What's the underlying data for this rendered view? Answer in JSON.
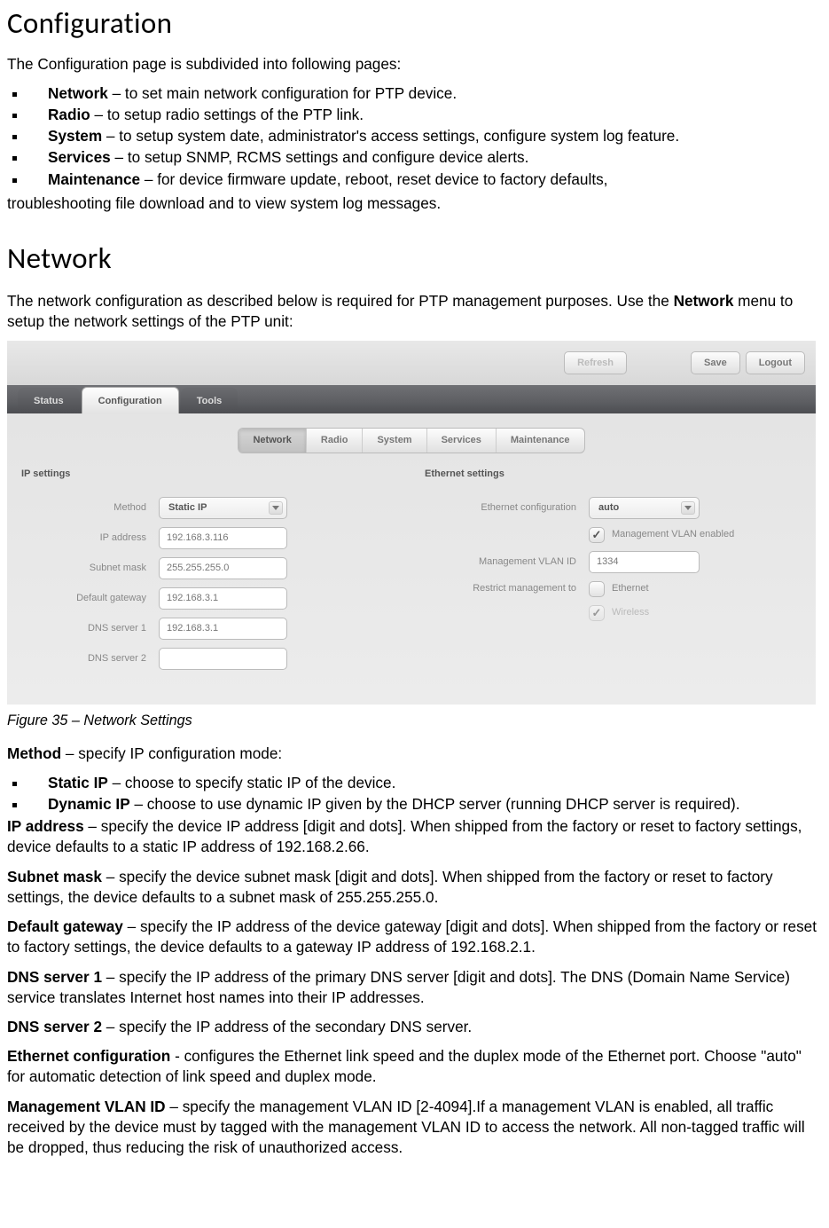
{
  "heading_config": "Configuration",
  "intro": "The Configuration page is subdivided into following pages:",
  "pages": [
    {
      "name": "Network",
      "desc": " – to set main network configuration for PTP device."
    },
    {
      "name": "Radio",
      "desc": " – to setup radio settings of the PTP link."
    },
    {
      "name": "System",
      "desc": " – to setup system date, administrator's access settings, configure system log feature."
    },
    {
      "name": "Services",
      "desc": " – to setup SNMP, RCMS settings and configure device alerts."
    },
    {
      "name": "Maintenance",
      "desc": " – for device firmware update, reboot, reset device to factory defaults,"
    }
  ],
  "maint_cont": "troubleshooting file download and to view system log messages.",
  "heading_network": "Network",
  "network_intro_1": "The network configuration as described below is required for PTP management purposes. Use the ",
  "network_intro_b": "Network",
  "network_intro_2": " menu to setup the network settings of the PTP unit:",
  "ui": {
    "topbar": {
      "refresh": "Refresh",
      "save": "Save",
      "logout": "Logout"
    },
    "maintabs": [
      "Status",
      "Configuration",
      "Tools"
    ],
    "subtabs": [
      "Network",
      "Radio",
      "System",
      "Services",
      "Maintenance"
    ],
    "ip": {
      "title": "IP settings",
      "method_lbl": "Method",
      "method_val": "Static IP",
      "addr_lbl": "IP address",
      "addr_val": "192.168.3.116",
      "mask_lbl": "Subnet mask",
      "mask_val": "255.255.255.0",
      "gw_lbl": "Default gateway",
      "gw_val": "192.168.3.1",
      "dns1_lbl": "DNS server 1",
      "dns1_val": "192.168.3.1",
      "dns2_lbl": "DNS server 2",
      "dns2_val": ""
    },
    "eth": {
      "title": "Ethernet settings",
      "config_lbl": "Ethernet configuration",
      "config_val": "auto",
      "vlan_chk_lbl": "Management VLAN enabled",
      "vlan_id_lbl": "Management VLAN ID",
      "vlan_id_val": "1334",
      "restrict_lbl": "Restrict management to",
      "restrict_eth": "Ethernet",
      "restrict_wifi": "Wireless"
    }
  },
  "caption": "Figure 35 – Network Settings",
  "defs": {
    "method_t": "Method",
    "method_d": " – specify IP configuration mode:",
    "static_t": "Static IP",
    "static_d": " – choose to specify static IP of the device.",
    "dyn_t": "Dynamic IP",
    "dyn_d": " – choose to use dynamic IP given by the DHCP server (running DHCP server is required).",
    "ip_t": "IP address",
    "ip_d": " – specify the device IP address [digit and dots]. When shipped from the factory or reset to factory settings, device defaults to a static IP address of 192.168.2.66.",
    "mask_t": "Subnet mask",
    "mask_d": " – specify the device subnet mask [digit and dots]. When shipped from the factory or reset to factory settings, the device defaults to a subnet mask of 255.255.255.0.",
    "gw_t": "Default gateway",
    "gw_d": " – specify the IP address of the device gateway [digit and dots]. When shipped from the factory or reset to factory settings, the device defaults to a gateway IP address of 192.168.2.1.",
    "dns1_t": "DNS server 1",
    "dns1_d": " – specify the IP address of the primary DNS server [digit and dots]. The DNS (Domain Name Service) service translates Internet host names into their IP addresses.",
    "dns2_t": "DNS server 2",
    "dns2_d": " – specify the IP address of the secondary DNS server.",
    "eth_t": "Ethernet configuration",
    "eth_d": " - configures the Ethernet link speed and the duplex mode of the Ethernet port. Choose \"auto\" for automatic detection of link speed and duplex mode.",
    "vlan_t": "Management VLAN ID",
    "vlan_d": " – specify the management VLAN ID [2-4094].If a management VLAN is enabled, all traffic received by the device must by tagged with the management VLAN ID to access the network. All non-tagged traffic will be dropped, thus reducing the risk of unauthorized access."
  }
}
